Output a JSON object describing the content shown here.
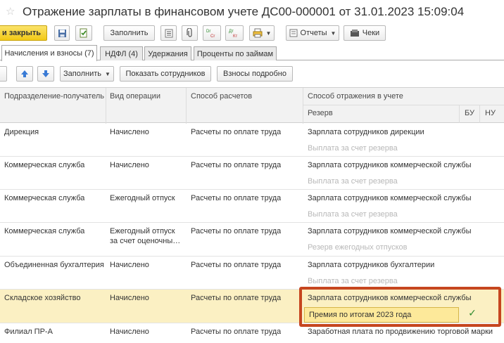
{
  "window": {
    "title": "Отражение зарплаты в финансовом учете ДС00-000001 от 31.01.2023 15:09:04"
  },
  "toolbar": {
    "post_close_label": "и закрыть",
    "fill_label": "Заполнить",
    "reports_label": "Отчеты",
    "receipts_label": "Чеки",
    "dt_label": "Дт",
    "kt_label": "Кт",
    "dr_label": "Dr",
    "cr_label": "Cr"
  },
  "tabs": [
    {
      "label": "Начисления и взносы (7)",
      "active": true
    },
    {
      "label": "НДФЛ (4)",
      "active": false
    },
    {
      "label": "Удержания",
      "active": false
    },
    {
      "label": "Проценты по займам",
      "active": false
    }
  ],
  "subtoolbar": {
    "fill_label": "Заполнить",
    "show_employees_label": "Показать сотрудников",
    "contributions_label": "Взносы подробно"
  },
  "grid": {
    "headers": {
      "department": "Подразделение-получатель",
      "operation": "Вид операции",
      "settlement": "Способ расчетов",
      "reflection": "Способ отражения в учете",
      "reserve": "Резерв",
      "bu": "БУ",
      "nu": "НУ"
    },
    "rows": [
      {
        "department": "Дирекция",
        "operation": "Начислено",
        "settlement": "Расчеты по оплате труда",
        "reflection": "Зарплата сотрудников дирекции",
        "reserve": "Выплата за счет резерва"
      },
      {
        "department": "Коммерческая служба",
        "operation": "Начислено",
        "settlement": "Расчеты по оплате труда",
        "reflection": "Зарплата сотрудников коммерческой службы",
        "reserve": "Выплата за счет резерва"
      },
      {
        "department": "Коммерческая служба",
        "operation": "Ежегодный отпуск",
        "settlement": "Расчеты по оплате труда",
        "reflection": "Зарплата сотрудников коммерческой службы",
        "reserve": "Выплата за счет резерва"
      },
      {
        "department": "Коммерческая служба",
        "operation": "Ежегодный отпуск за счет оценочны…",
        "settlement": "Расчеты по оплате труда",
        "reflection": "Зарплата сотрудников коммерческой службы",
        "reserve": "Резерв ежегодных отпусков"
      },
      {
        "department": "Объединенная бухгалтерия",
        "operation": "Начислено",
        "settlement": "Расчеты по оплате труда",
        "reflection": "Зарплата сотрудников бухгалтерии",
        "reserve": "Выплата за счет резерва"
      },
      {
        "department": "Складское хозяйство",
        "operation": "Начислено",
        "settlement": "Расчеты по оплате труда",
        "reflection": "Зарплата сотрудников коммерческой службы",
        "reserve": "Премия по итогам 2023 года",
        "check": "✓"
      },
      {
        "department": "Филиал ПР-А",
        "operation": "Начислено",
        "settlement": "Расчеты по оплате труда",
        "reflection": "Заработная плата по продвижению торговой марки",
        "reserve": ""
      }
    ]
  },
  "colors": {
    "primary_button": "#f2c916",
    "selected_row": "#fbf0c3",
    "edit_field": "#fde99a",
    "highlight_border": "#c6461f",
    "check": "#2e8b2e"
  }
}
